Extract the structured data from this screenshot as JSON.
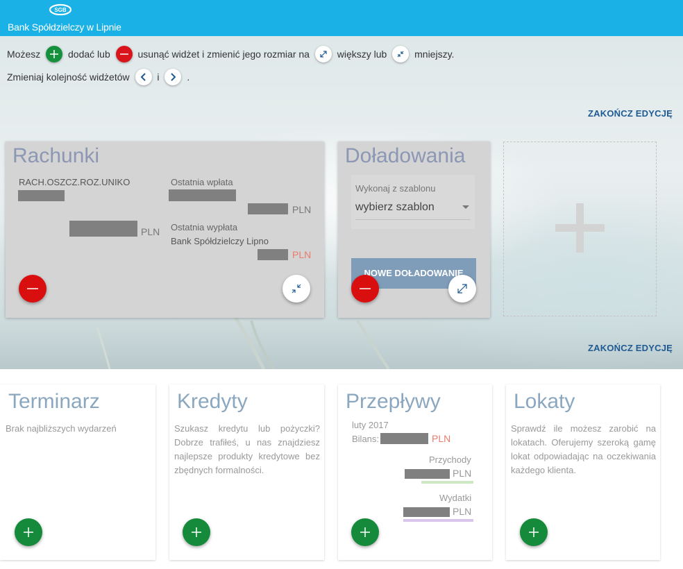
{
  "header": {
    "bank_name": "Bank Spółdzielczy w Lipnie",
    "logo_text": "SGB",
    "color": "#1ab1e6"
  },
  "instructions": {
    "line1_part1": "Możesz",
    "line1_part2": "dodać lub",
    "line1_part3": "usunąć widżet i zmienić jego rozmiar na",
    "line1_part4": "większy lub",
    "line1_part5": "mniejszy.",
    "line2_part1": "Zmieniaj kolejność widżetów",
    "line2_part2": "i",
    "line2_part3": "."
  },
  "end_edit_label": "ZAKOŃCZ EDYCJĘ",
  "rachunki": {
    "title": "Rachunki",
    "account_name": "RACH.OSZCZ.ROZ.UNIKO",
    "last_deposit_label": "Ostatnia wpłata",
    "last_withdrawal_label": "Ostatnia wypłata",
    "last_withdrawal_source": "Bank Spółdzielczy Lipno",
    "currency": "PLN"
  },
  "doladowania": {
    "title": "Doładowania",
    "template_label": "Wykonaj z szablonu",
    "template_value": "wybierz szablon",
    "new_button": "NOWE DOŁADOWANIE"
  },
  "cards": {
    "terminarz": {
      "title": "Terminarz",
      "text": "Brak najbliższych wydarzeń"
    },
    "kredyty": {
      "title": "Kredyty",
      "text": "Szukasz kredytu lub pożyczki? Dobrze trafiłeś, u nas znajdziesz najlepsze produkty kredytowe bez zbędnych formalności."
    },
    "przeplywy": {
      "title": "Przepływy",
      "month": "luty 2017",
      "balance_label": "Bilans:",
      "income_label": "Przychody",
      "expense_label": "Wydatki",
      "currency": "PLN"
    },
    "lokaty": {
      "title": "Lokaty",
      "text": "Sprawdź ile możesz zarobić na lokatach. Oferujemy szeroką gamę lokat odpowiadając na oczekiwania każdego klienta."
    }
  },
  "colors": {
    "add": "#15913e",
    "remove": "#d9141b",
    "link": "#1f5a93",
    "negative_amount": "#ea7b6d",
    "income_bar": "#cfe8c4",
    "expense_bar": "#d9c6ea"
  }
}
